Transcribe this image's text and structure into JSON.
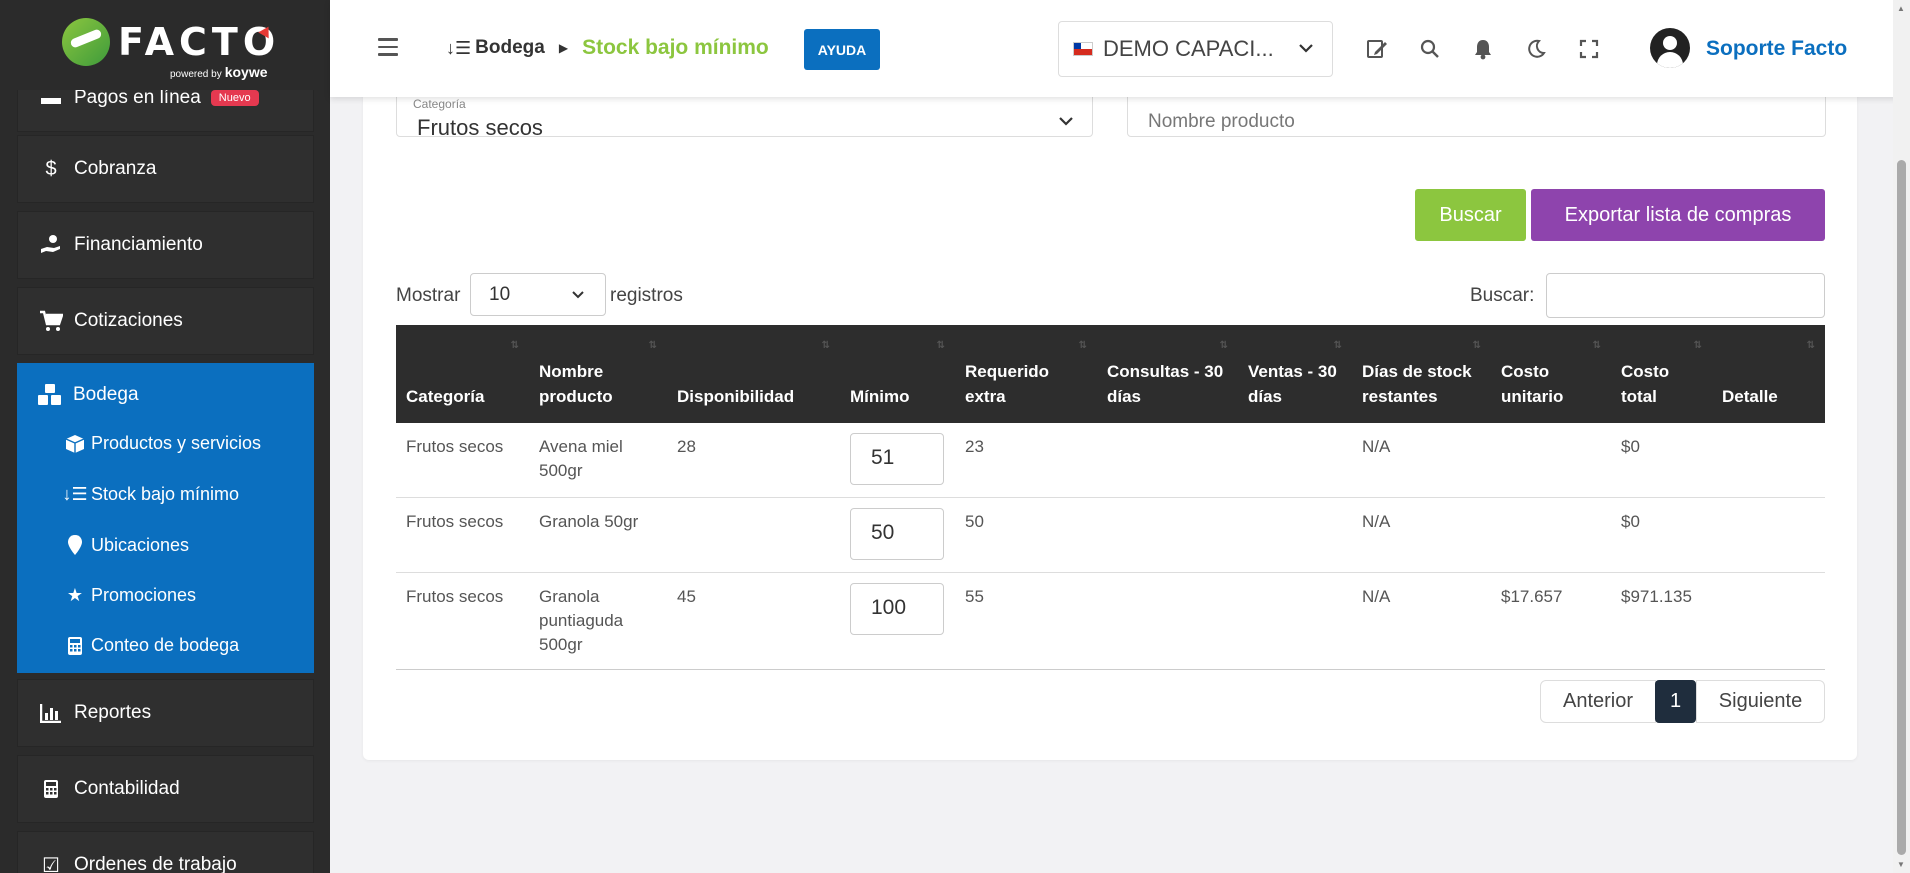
{
  "brand": {
    "logo_text": "FACTO",
    "logo_sub_prefix": "powered by",
    "logo_sub_brand": "koywe"
  },
  "sidebar": {
    "top_partial": {
      "label": "Pagos en línea",
      "badge": "Nuevo"
    },
    "items": [
      {
        "label": "Cobranza",
        "icon": "dollar-icon"
      },
      {
        "label": "Financiamiento",
        "icon": "hand-money-icon"
      },
      {
        "label": "Cotizaciones",
        "icon": "cart-icon"
      }
    ],
    "active": {
      "label": "Bodega",
      "icon": "boxes-icon",
      "subitems": [
        {
          "label": "Productos y servicios",
          "icon": "cube-icon"
        },
        {
          "label": "Stock bajo mínimo",
          "icon": "sort-down-icon"
        },
        {
          "label": "Ubicaciones",
          "icon": "map-pin-icon"
        },
        {
          "label": "Promociones",
          "icon": "star-icon"
        },
        {
          "label": "Conteo de bodega",
          "icon": "calculator-icon"
        }
      ]
    },
    "bottom_items": [
      {
        "label": "Reportes",
        "icon": "chart-icon"
      },
      {
        "label": "Contabilidad",
        "icon": "calculator-icon"
      },
      {
        "label": "Ordenes de trabajo",
        "icon": "checklist-icon"
      }
    ]
  },
  "header": {
    "breadcrumb_parent": "Bodega",
    "breadcrumb_current": "Stock bajo mínimo",
    "help_label": "AYUDA",
    "company": "DEMO CAPACI...",
    "user_name": "Soporte Facto"
  },
  "filters": {
    "category_label": "Categoría",
    "category_value": "Frutos secos",
    "product_placeholder": "Nombre producto"
  },
  "actions": {
    "search_label": "Buscar",
    "export_label": "Exportar lista de compras"
  },
  "table_controls": {
    "show_label": "Mostrar",
    "show_value": "10",
    "records_label": "registros",
    "search_label": "Buscar:",
    "search_value": ""
  },
  "table": {
    "columns": [
      "Categoría",
      "Nombre producto",
      "Disponibilidad",
      "Mínimo",
      "Requerido extra",
      "Consultas - 30 días",
      "Ventas - 30 días",
      "Días de stock restantes",
      "Costo unitario",
      "Costo total",
      "Detalle"
    ],
    "rows": [
      {
        "categoria": "Frutos secos",
        "nombre": "Avena miel 500gr",
        "disponibilidad": "28",
        "minimo": "51",
        "requerido": "23",
        "consultas": "",
        "ventas": "",
        "dias": "N/A",
        "costo_unitario": "",
        "costo_total": "$0",
        "detalle": ""
      },
      {
        "categoria": "Frutos secos",
        "nombre": "Granola 50gr",
        "disponibilidad": "",
        "minimo": "50",
        "requerido": "50",
        "consultas": "",
        "ventas": "",
        "dias": "N/A",
        "costo_unitario": "",
        "costo_total": "$0",
        "detalle": ""
      },
      {
        "categoria": "Frutos secos",
        "nombre": "Granola puntiaguda 500gr",
        "disponibilidad": "45",
        "minimo": "100",
        "requerido": "55",
        "consultas": "",
        "ventas": "",
        "dias": "N/A",
        "costo_unitario": "$17.657",
        "costo_total": "$971.135",
        "detalle": ""
      }
    ]
  },
  "pagination": {
    "prev_label": "Anterior",
    "current_page": "1",
    "next_label": "Siguiente"
  },
  "colors": {
    "brand_blue": "#0b6fbf",
    "brand_green": "#8cc63f",
    "export_purple": "#8e44ad",
    "sidebar_bg": "#2b2b2b"
  }
}
